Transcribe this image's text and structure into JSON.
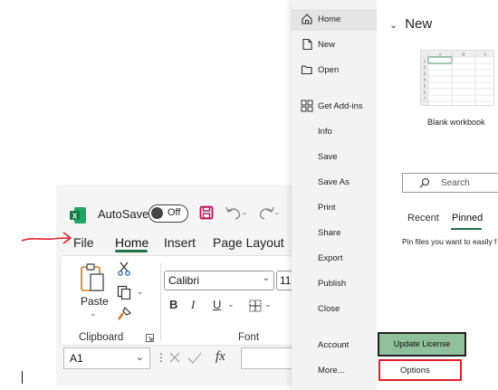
{
  "ribbon": {
    "autosave_label": "AutoSave",
    "autosave_state": "Off",
    "tabs": [
      "File",
      "Home",
      "Insert",
      "Page Layout"
    ],
    "clipboard": {
      "paste_label": "Paste",
      "group_label": "Clipboard"
    },
    "font": {
      "family": "Calibri",
      "size": "11",
      "group_label": "Font",
      "format_buttons": [
        "B",
        "I",
        "U"
      ]
    },
    "formula_bar": {
      "name_box": "A1",
      "fx": "fx"
    },
    "accent_color": "#217346"
  },
  "backstage": {
    "nav_items": [
      "Home",
      "New",
      "Open",
      "Get Add-ins",
      "Info",
      "Save",
      "Save As",
      "Print",
      "Share",
      "Export",
      "Publish",
      "Close",
      "Account",
      "More..."
    ],
    "update_license": "Update License",
    "options": "Options",
    "new_heading": "New",
    "blank_workbook": "Blank workbook",
    "thumb_columns": [
      "A",
      "B",
      "C"
    ],
    "thumb_rows": [
      "1",
      "2",
      "3",
      "4",
      "5",
      "6",
      "7"
    ],
    "search_placeholder": "Search",
    "tabs": [
      "Recent",
      "Pinned"
    ],
    "pin_text": "Pin files you want to easily f",
    "highlight_color": "#e0202a"
  }
}
